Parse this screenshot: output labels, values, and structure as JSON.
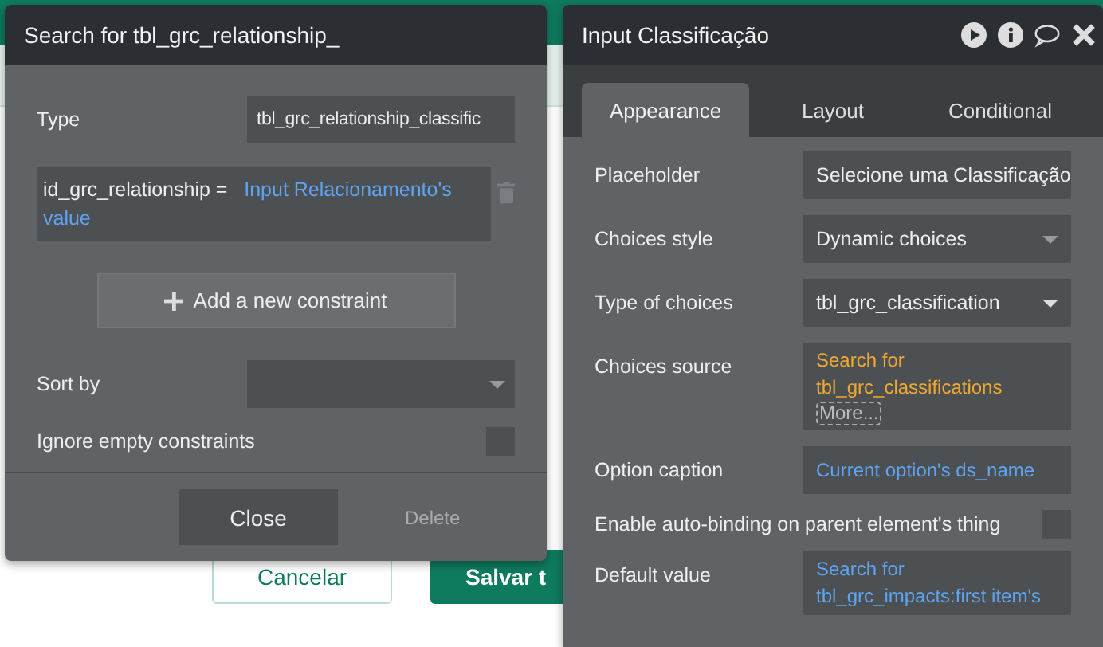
{
  "background": {
    "cancel_button": "Cancelar",
    "save_button": "Salvar t"
  },
  "search_panel": {
    "title": "Search for tbl_grc_relationship_",
    "type_label": "Type",
    "type_value": "tbl_grc_relationship_classific",
    "constraint": {
      "field": "id_grc_relationship =",
      "value": "Input Relacionamento's value"
    },
    "add_button": "Add a new constraint",
    "sort_label": "Sort by",
    "ignore_label": "Ignore empty constraints",
    "ignore_checked": false,
    "close_button": "Close",
    "delete_button": "Delete"
  },
  "property_panel": {
    "title": "Input Classificação",
    "tabs": [
      {
        "label": "Appearance",
        "selected": true
      },
      {
        "label": "Layout",
        "selected": false
      },
      {
        "label": "Conditional",
        "selected": false
      }
    ],
    "properties": [
      {
        "kind": "text",
        "label": "Placeholder",
        "value": "Selecione uma Classificação"
      },
      {
        "kind": "dropdown",
        "label": "Choices style",
        "value": "Dynamic choices"
      },
      {
        "kind": "dropdown",
        "label": "Type of choices",
        "value": "tbl_grc_classification"
      },
      {
        "kind": "expression",
        "label": "Choices source",
        "value": "Search for tbl_grc_classifications",
        "more": "More...",
        "color": "#f0a830"
      },
      {
        "kind": "expression",
        "label": "Option caption",
        "value": "Current option's ds_name",
        "color": "#5ea4f0"
      },
      {
        "kind": "checkbox",
        "label": "Enable auto-binding on parent element's thing",
        "checked": false
      },
      {
        "kind": "expression",
        "label": "Default value",
        "value": "Search for tbl_grc_impacts:first item's",
        "color": "#5ea4f0"
      }
    ]
  }
}
